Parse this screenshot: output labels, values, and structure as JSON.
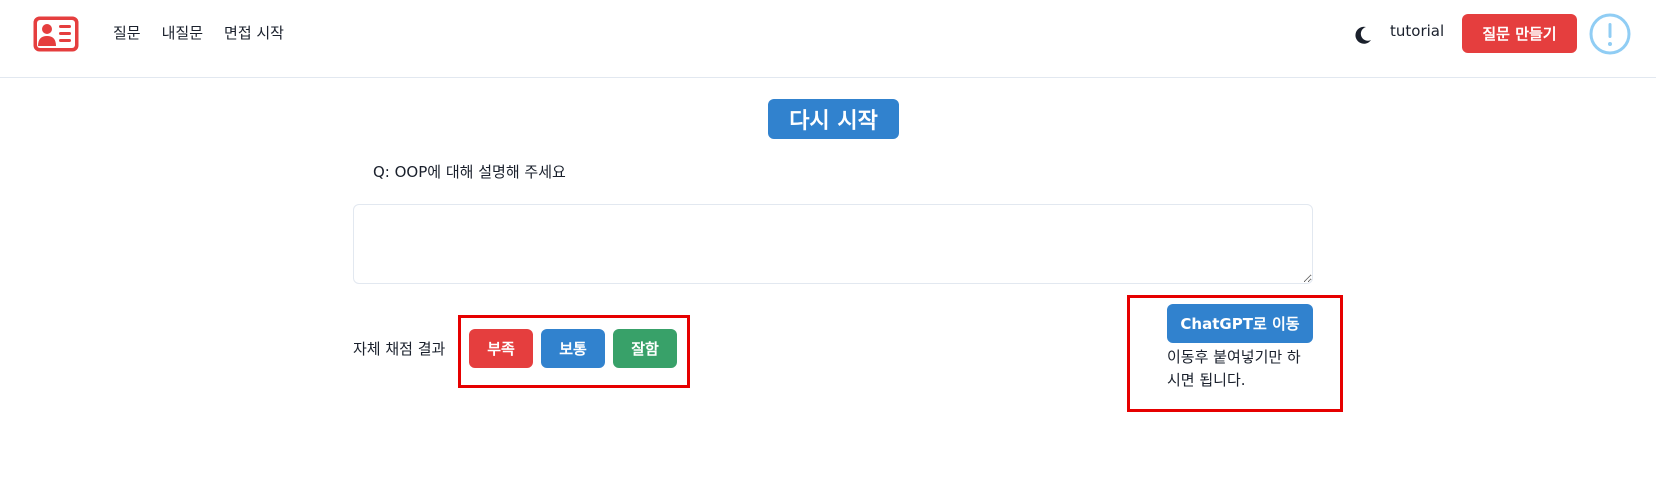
{
  "nav": {
    "links": [
      "질문",
      "내질문",
      "면접 시작"
    ],
    "tutorial_label": "tutorial",
    "make_question_label": "질문 만들기"
  },
  "main": {
    "restart_label": "다시 시작",
    "question": "Q: OOP에 대해 설명해 주세요",
    "answer_value": "",
    "self_score_label": "자체 채점 결과",
    "score_buttons": [
      "부족",
      "보통",
      "잘함"
    ],
    "chatgpt_button_label": "ChatGPT로 이동",
    "chatgpt_note": "이동후 붙여넣기만 하시면 됩니다."
  },
  "icons": {
    "logo": "id-card-icon",
    "theme": "moon-icon",
    "info": "exclamation-circle-icon"
  },
  "colors": {
    "primary_blue": "#3182ce",
    "danger_red": "#e53e3e",
    "success_green": "#38a169",
    "info_circle": "#90cdf4",
    "highlight_frame": "#e60000"
  }
}
